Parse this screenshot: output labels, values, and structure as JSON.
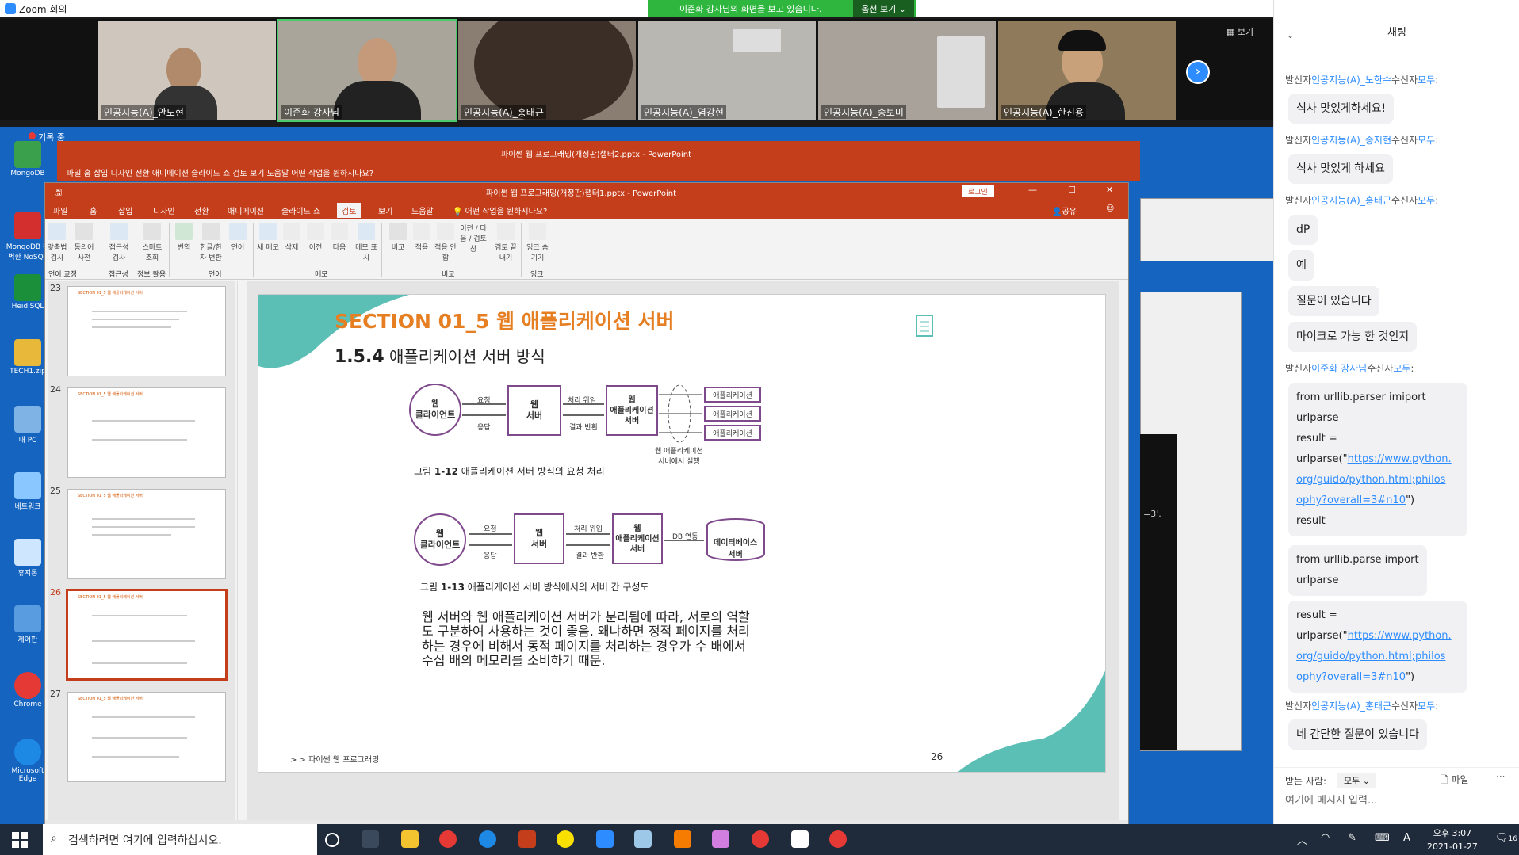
{
  "zoom": {
    "window_title": "Zoom 회의",
    "share_banner": "이준화 강사님의 화면을 보고 있습니다.",
    "options_label": "옵션 보기 ⌄",
    "view_label": "보기",
    "recording_label": "기록 중",
    "participants": [
      {
        "name": "인공지능(A)_안도현"
      },
      {
        "name": "이준화 강사님"
      },
      {
        "name": "인공지능(A)_홍태근"
      },
      {
        "name": "인공지능(A)_염강현"
      },
      {
        "name": "인공지능(A)_송보미"
      },
      {
        "name": "인공지능(A)_한진용"
      }
    ]
  },
  "desktop_icons": [
    {
      "label": "MongoDB",
      "color": "#3aa04b"
    },
    {
      "label": "MongoDB 완벽한 NoSQL",
      "color": "#d32f2f"
    },
    {
      "label": "HeidiSQL",
      "color": "#1b8f3a"
    },
    {
      "label": "TECH1.zip",
      "color": "#e8b83b"
    },
    {
      "label": "내 PC",
      "color": "#7fb2e5"
    },
    {
      "label": "네트워크",
      "color": "#8ac6ff"
    },
    {
      "label": "휴지통",
      "color": "#cfe6ff"
    },
    {
      "label": "제어판",
      "color": "#5a9ce0"
    },
    {
      "label": "Chrome",
      "color": "#e53935"
    },
    {
      "label": "Microsoft Edge",
      "color": "#1e88e5"
    }
  ],
  "ppt_back": {
    "title": "파이썬 웹 프로그래밍(개정판)챕터2.pptx  -  PowerPoint",
    "tabs": "파일   홈   삽입   디자인   전환   애니메이션   슬라이드 쇼   검토   보기   도움말   어떤 작업을 원하시나요?"
  },
  "ppt": {
    "title": "파이썬 웹 프로그래밍(개정판)챕터1.pptx  -  PowerPoint",
    "login": "로그인",
    "share": "공유",
    "tell_me": "어떤 작업을 원하시나요?",
    "tabs": [
      "파일",
      "홈",
      "삽입",
      "디자인",
      "전환",
      "애니메이션",
      "슬라이드 쇼",
      "검토",
      "보기",
      "도움말"
    ],
    "selected_tab": "검토",
    "ribbon_buttons": [
      "맞춤법 검사",
      "동의어 사전",
      "접근성 검사",
      "스마트 조회",
      "번역",
      "한글/한자 변환",
      "언어",
      "새 메모",
      "삭제",
      "이전",
      "다음",
      "메모 표시",
      "비교",
      "적용",
      "적용 안 함",
      "이전",
      "다음",
      "검토 창",
      "검토 끝내기",
      "잉크 숨기기"
    ],
    "ribbon_groups": [
      "언어 교정",
      "접근성",
      "정보 활용",
      "언어",
      "메모",
      "비교",
      "잉크"
    ],
    "slide_numbers": [
      "23",
      "24",
      "25",
      "26",
      "27"
    ],
    "thumb_title": "SECTION 01_5 웹 애플리케이션 서버",
    "slide": {
      "title": "SECTION 01_5 웹 애플리케이션 서버",
      "sub_num": "1.5.4",
      "sub_text": "애플리케이션 서버 방식",
      "diag1": {
        "client": "웹\n클라이언트",
        "web_server": "웹\n서버",
        "was": "웹\n애플리케이션\n서버",
        "apps": [
          "애플리케이션",
          "애플리케이션",
          "애플리케이션"
        ],
        "req": "요청",
        "resp": "응답",
        "delegate": "처리 위임",
        "result": "결과 반환",
        "exec_note": "웹 애플리케이션\n서버에서 실행",
        "caption_prefix": "그림 ",
        "caption_num": "1-12",
        "caption_text": " 애플리케이션 서버 방식의 요청 처리"
      },
      "diag2": {
        "client": "웹\n클라이언트",
        "web_server": "웹\n서버",
        "was": "웹\n애플리케이션\n서버",
        "db": "데이터베이스\n서버",
        "req": "요청",
        "resp": "응답",
        "delegate": "처리 위임",
        "result": "결과 반환",
        "db_link": "DB 연동",
        "caption_prefix": "그림 ",
        "caption_num": "1-13",
        "caption_text": " 애플리케이션 서버 방식에서의 서버 간 구성도"
      },
      "body": "웹 서버와 웹 애플리케이션 서버가 분리됨에 따라, 서로의 역할도 구분하여 사용하는 것이 좋음. 왜냐하면 정적 페이지를 처리하는 경우에 비해서 동적 페이지를 처리하는 경우가 수 배에서 수십 배의 메모리를 소비하기 때문.",
      "footer": "> > 파이썬 웹 프로그래밍",
      "page": "26"
    }
  },
  "console": {
    "text": "=3'."
  },
  "chat": {
    "title": "채팅",
    "messages": [
      {
        "prefix": "발신자",
        "sender": "인공지능(A)_노한수",
        "mid": "수신자",
        "to": "모두",
        "suffix": ":",
        "text": "식사 맛있게하세요!"
      },
      {
        "prefix": "발신자",
        "sender": "인공지능(A)_송지현",
        "mid": "수신자",
        "to": "모두",
        "suffix": ":",
        "text": "식사 맛있게 하세요"
      },
      {
        "prefix": "발신자",
        "sender": "인공지능(A)_홍태근",
        "mid": "수신자",
        "to": "모두",
        "suffix": ":",
        "texts": [
          "dP",
          "예",
          "질문이 있습니다",
          "마이크로 가능 한 것인지"
        ]
      },
      {
        "prefix": "발신자",
        "sender": "이준화 강사님",
        "mid": "수신자",
        "to": "모두",
        "suffix": ":"
      }
    ],
    "code1": [
      "from urllib.parser imiport",
      "urlparse",
      "result =",
      "urlparse(\"",
      "https://www.python.",
      "org/guido/python.html;philos",
      "ophy?overall=3#n10",
      "\")",
      "result"
    ],
    "code2": [
      "from urllib.parse import",
      "urlparse"
    ],
    "code3": [
      "result =",
      "urlparse(\"",
      "https://www.python.",
      "org/guido/python.html;philos",
      "ophy?overall=3#n10",
      "\")"
    ],
    "last": {
      "prefix": "발신자",
      "sender": "인공지능(A)_홍태근",
      "mid": "수신자",
      "to": "모두",
      "suffix": ":",
      "text": "네 간단한 질문이 있습니다"
    },
    "to_label": "받는 사람:",
    "to_value": "모두 ⌄",
    "file_label": "파일",
    "input_placeholder": "여기에 메시지 입력..."
  },
  "taskbar": {
    "search_placeholder": "검색하려면 여기에 입력하십시오.",
    "time": "오후 3:07",
    "date": "2021-01-27",
    "ime": "A",
    "notif": "16"
  }
}
